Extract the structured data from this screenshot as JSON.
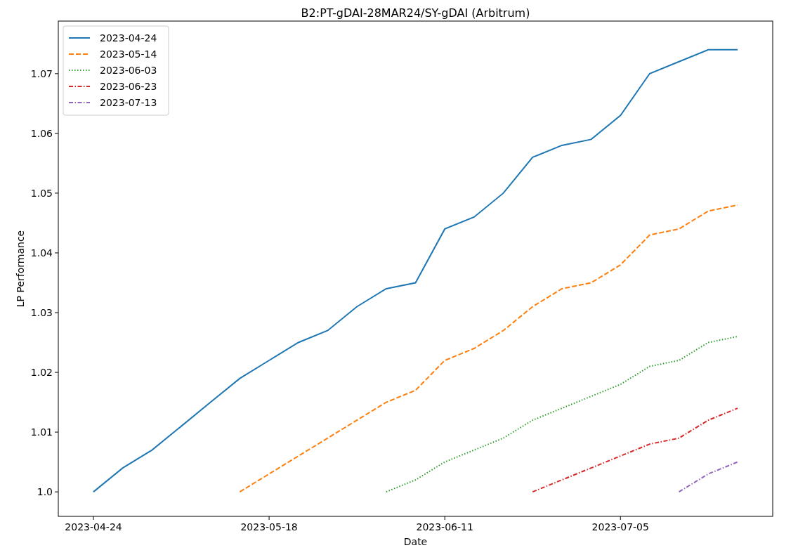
{
  "chart_data": {
    "type": "line",
    "title": "B2:PT-gDAI-28MAR24/SY-gDAI (Arbitrum)",
    "xlabel": "Date",
    "ylabel": "LP Performance",
    "categories": [
      "2023-04-24",
      null,
      null,
      null,
      null,
      null,
      "2023-05-18",
      null,
      null,
      null,
      null,
      null,
      "2023-06-11",
      null,
      null,
      null,
      null,
      null,
      "2023-07-05",
      null,
      null,
      null,
      null
    ],
    "series": [
      {
        "name": "2023-04-24",
        "color": "#1f77b4",
        "line_style": "solid",
        "values": [
          1.0,
          1.004,
          1.007,
          1.011,
          1.015,
          1.019,
          1.022,
          1.025,
          1.027,
          1.031,
          1.034,
          1.035,
          1.044,
          1.046,
          1.05,
          1.056,
          1.058,
          1.059,
          1.063,
          1.07,
          1.072,
          1.074,
          1.074
        ]
      },
      {
        "name": "2023-05-14",
        "color": "#ff7f0e",
        "line_style": "dashed",
        "values": [
          null,
          null,
          null,
          null,
          null,
          1.0,
          1.003,
          1.006,
          1.009,
          1.012,
          1.015,
          1.017,
          1.022,
          1.024,
          1.027,
          1.031,
          1.034,
          1.035,
          1.038,
          1.043,
          1.044,
          1.047,
          1.048
        ]
      },
      {
        "name": "2023-06-03",
        "color": "#2ca02c",
        "line_style": "dotted",
        "values": [
          null,
          null,
          null,
          null,
          null,
          null,
          null,
          null,
          null,
          null,
          1.0,
          1.002,
          1.005,
          1.007,
          1.009,
          1.012,
          1.014,
          1.016,
          1.018,
          1.021,
          1.022,
          1.025,
          1.026
        ]
      },
      {
        "name": "2023-06-23",
        "color": "#d62728",
        "line_style": "dashdot",
        "values": [
          null,
          null,
          null,
          null,
          null,
          null,
          null,
          null,
          null,
          null,
          null,
          null,
          null,
          null,
          null,
          1.0,
          1.002,
          1.004,
          1.006,
          1.008,
          1.009,
          1.012,
          1.014
        ]
      },
      {
        "name": "2023-07-13",
        "color": "#9467bd",
        "line_style": "dashdot",
        "values": [
          null,
          null,
          null,
          null,
          null,
          null,
          null,
          null,
          null,
          null,
          null,
          null,
          null,
          null,
          null,
          null,
          null,
          null,
          null,
          null,
          1.0,
          1.003,
          1.005
        ]
      }
    ],
    "ylim": [
      0.9959,
      1.0788
    ],
    "yticks": [
      {
        "value": 1.0,
        "label": "1.0"
      },
      {
        "value": 1.01,
        "label": "1.01"
      },
      {
        "value": 1.02,
        "label": "1.02"
      },
      {
        "value": 1.03,
        "label": "1.03"
      },
      {
        "value": 1.04,
        "label": "1.04"
      },
      {
        "value": 1.05,
        "label": "1.05"
      },
      {
        "value": 1.06,
        "label": "1.06"
      },
      {
        "value": 1.07,
        "label": "1.07"
      }
    ],
    "legend": true
  }
}
